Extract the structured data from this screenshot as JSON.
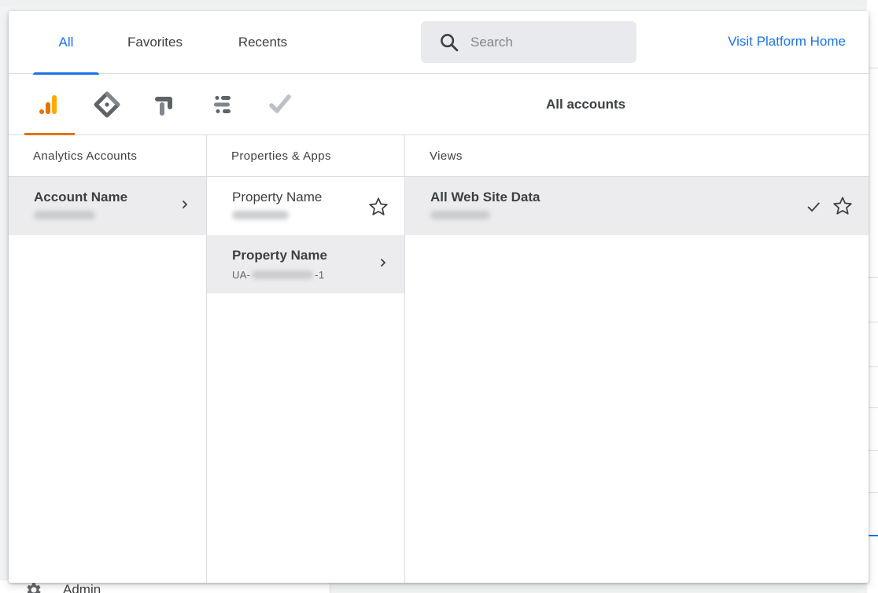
{
  "tabs": [
    {
      "label": "All",
      "active": true
    },
    {
      "label": "Favorites",
      "active": false
    },
    {
      "label": "Recents",
      "active": false
    }
  ],
  "search": {
    "placeholder": "Search"
  },
  "visit_link": "Visit Platform Home",
  "products": [
    {
      "icon": "analytics-icon",
      "active": true
    },
    {
      "icon": "tag-manager-icon",
      "active": false
    },
    {
      "icon": "optimize-icon",
      "active": false
    },
    {
      "icon": "data-studio-icon",
      "active": false
    },
    {
      "icon": "surveys-icon",
      "active": false
    }
  ],
  "all_accounts_label": "All accounts",
  "columns": {
    "accounts": {
      "header": "Analytics Accounts",
      "items": [
        {
          "title": "Account Name",
          "selected": true
        }
      ]
    },
    "properties": {
      "header": "Properties & Apps",
      "items": [
        {
          "title": "Property Name",
          "selected": false
        },
        {
          "title": "Property Name",
          "sub_prefix": "UA-",
          "sub_suffix": "-1",
          "selected": true
        }
      ]
    },
    "views": {
      "header": "Views",
      "items": [
        {
          "title": "All Web Site Data",
          "selected": true
        }
      ]
    }
  },
  "background": {
    "admin_label": "Admin"
  },
  "colors": {
    "accent": "#1a73e8",
    "analytics_orange": "#e8710a",
    "selected_row": "#ececee"
  }
}
